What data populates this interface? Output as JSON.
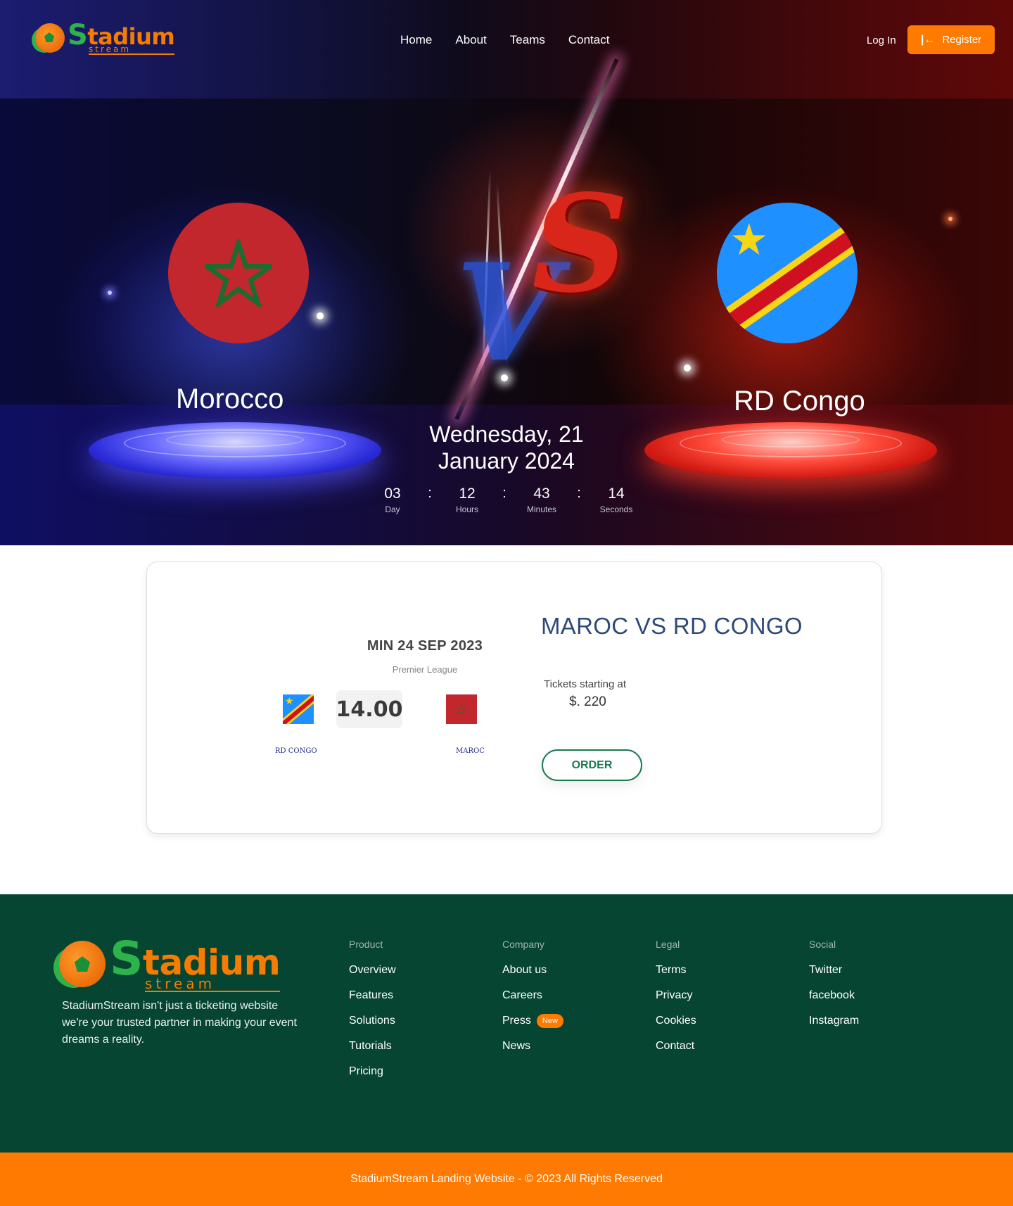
{
  "brand": {
    "logo_main": "tadium",
    "logo_initial": "S",
    "logo_sub": "stream"
  },
  "nav": {
    "items": [
      "Home",
      "About",
      "Teams",
      "Contact"
    ],
    "login_label": "Log In",
    "register_label": "Register"
  },
  "hero": {
    "team_home": "Morocco",
    "team_away": "RD Congo",
    "vs_left": "V",
    "vs_right": "S",
    "date": "Wednesday, 21 January 2024",
    "countdown": [
      {
        "value": "03",
        "label": "Day"
      },
      {
        "value": "12",
        "label": "Hours"
      },
      {
        "value": "43",
        "label": "Minutes"
      },
      {
        "value": "14",
        "label": "Seconds"
      }
    ],
    "separator": ":"
  },
  "match_card": {
    "date": "MIN 24 SEP 2023",
    "league": "Premier League",
    "time": "14.00",
    "team_left": "RD CONGO",
    "team_right": "MAROC",
    "title": "MAROC VS RD CONGO",
    "tickets_label": "Tickets starting at",
    "tickets_price": "$. 220",
    "order_label": "ORDER"
  },
  "footer": {
    "description": "StadiumStream isn't just a ticketing website we're your trusted partner in making your event dreams a reality.",
    "columns": [
      {
        "title": "Product",
        "links": [
          "Overview",
          "Features",
          "Solutions",
          "Tutorials",
          "Pricing"
        ]
      },
      {
        "title": "Company",
        "links": [
          "About us",
          "Careers",
          "Press",
          "News"
        ]
      },
      {
        "title": "Legal",
        "links": [
          "Terms",
          "Privacy",
          "Cookies",
          "Contact"
        ]
      },
      {
        "title": "Social",
        "links": [
          "Twitter",
          "facebook",
          "Instagram"
        ]
      }
    ],
    "press_badge": "New",
    "copyright": "StadiumStream Landing Website - © 2023 All Rights Reserved"
  },
  "colors": {
    "accent": "#ff7a00",
    "footer_bg": "#064532",
    "logo_green": "#2db34a",
    "card_title": "#2e4a7a",
    "order_green": "#1b7a4e"
  },
  "icons": {
    "register": "login-arrow-icon",
    "flag_home": "morocco-flag-icon",
    "flag_away": "dr-congo-flag-icon"
  }
}
